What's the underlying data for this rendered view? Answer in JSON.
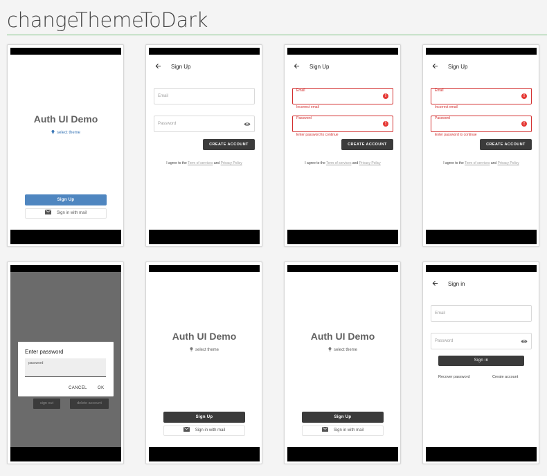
{
  "page": {
    "title": "changeThemeToDark"
  },
  "home": {
    "status_bar": "",
    "app_title": "Auth UI Demo",
    "theme_link": "select theme",
    "signup_label": "Sign Up",
    "mail_label": "Sign in with mail",
    "accent_color": "#4f86c0",
    "dark_color": "#3b3b3b"
  },
  "signup": {
    "title": "Sign Up",
    "email_placeholder": "Email",
    "password_placeholder": "Password",
    "email_label": "Email",
    "password_label": "Password",
    "email_error": "Incorrect email",
    "password_error": "Enter password to continue",
    "create_label": "CREATE ACCOUNT",
    "terms_prefix": "I agree to the",
    "terms_link": "Term of services",
    "terms_and": "and",
    "privacy_link": "Privacy Policy",
    "error_color": "#d32f2f"
  },
  "dialog": {
    "title": "Enter password",
    "input_value": "password",
    "cancel_label": "CANCEL",
    "ok_label": "OK",
    "sign_out_label": "sign out",
    "delete_label": "delete account"
  },
  "signin": {
    "title": "Sign in",
    "email_placeholder": "Email",
    "password_placeholder": "Password",
    "signin_label": "Sign in",
    "recover_label": "Recover password",
    "create_label": "Create account"
  },
  "icons": [
    "back-arrow-icon",
    "bulb-icon",
    "mail-icon",
    "eye-icon",
    "error-icon"
  ]
}
